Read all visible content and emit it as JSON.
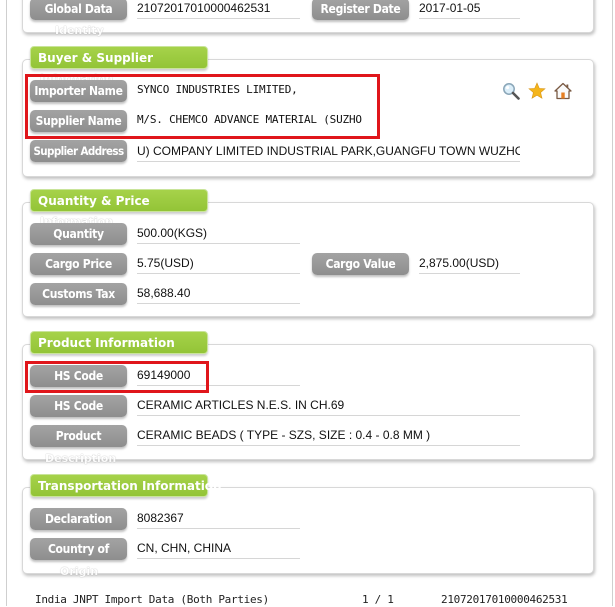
{
  "top_section": {
    "rows": [
      {
        "label": "Global Data",
        "value": "21072017010000462531",
        "right_label": "Register Date",
        "right_value": "2017-01-05",
        "ghost": "Identity"
      }
    ]
  },
  "buyer_supplier": {
    "title": "Buyer & Supplier",
    "ghost": "Information",
    "importer_label": "Importer Name",
    "importer_value": "SYNCO INDUSTRIES LIMITED,",
    "supplier_label": "Supplier Name",
    "supplier_value": "M/S. CHEMCO ADVANCE MATERIAL (SUZHO",
    "address_label": "Supplier Address",
    "address_value": "U) COMPANY LIMITED INDUSTRIAL PARK,GUANGFU TOWN WUZHONG",
    "icons": [
      "search-icon",
      "star-icon",
      "home-icon"
    ]
  },
  "quantity_price": {
    "title": "Quantity & Price",
    "ghost": "Information",
    "quantity_label": "Quantity",
    "quantity_value": "500.00(KGS)",
    "cargo_price_label": "Cargo Price",
    "cargo_price_value": "5.75(USD)",
    "cargo_value_label": "Cargo Value",
    "cargo_value_value": "2,875.00(USD)",
    "customs_tax_label": "Customs Tax",
    "customs_tax_value": "58,688.40"
  },
  "product_info": {
    "title": "Product Information",
    "hs_code_label": "HS Code",
    "hs_code_value": "69149000",
    "hs_desc_label": "HS Code",
    "hs_desc_value": "CERAMIC ARTICLES N.E.S. IN CH.69",
    "product_label": "Product",
    "product_value": "CERAMIC BEADS ( TYPE - SZS, SIZE : 0.4 - 0.8 MM )",
    "ghost": "Description"
  },
  "transportation": {
    "title": "Transportation Information",
    "declaration_label": "Declaration",
    "declaration_value": "8082367",
    "country_label": "Country of",
    "country_value": "CN, CHN, CHINA",
    "ghost": "Origin"
  },
  "footer": {
    "source": "India JNPT Import Data (Both Parties)",
    "page": "1 / 1",
    "record_id": "21072017010000462531"
  },
  "colors": {
    "section_header": "#9bc940",
    "label_pill": "#999999",
    "highlight_border": "#e0161b"
  }
}
